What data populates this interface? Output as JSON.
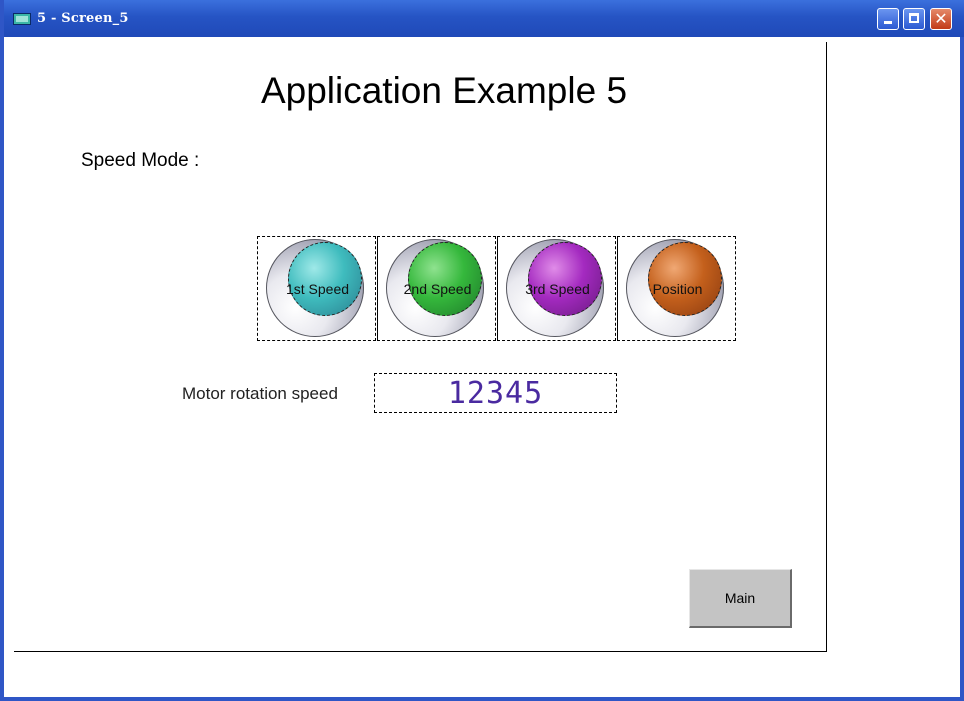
{
  "window": {
    "title": "5 - Screen_5"
  },
  "screen": {
    "title": "Application Example 5",
    "speed_mode_label": "Speed Mode :",
    "buttons": [
      {
        "label": "1st Speed",
        "color": "#3fbcbe"
      },
      {
        "label": "2nd Speed",
        "color": "#35b83c"
      },
      {
        "label": "3rd Speed",
        "color": "#a42ac0"
      },
      {
        "label": "Position",
        "color": "#c4601c"
      }
    ],
    "motor_label": "Motor rotation speed",
    "motor_value": "12345",
    "main_button": "Main"
  }
}
